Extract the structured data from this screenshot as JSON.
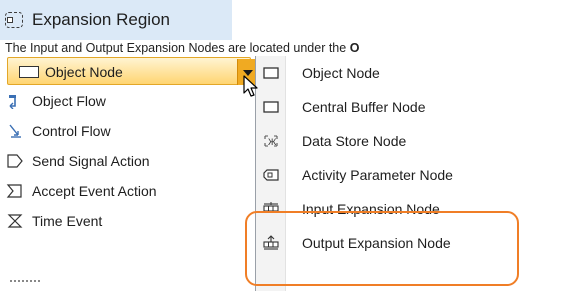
{
  "header": {
    "label": "Expansion Region",
    "icon": "expansion-region-icon"
  },
  "sentence": {
    "text": "The Input and Output Expansion Nodes are located under the ",
    "bold": "O"
  },
  "palette": {
    "selected": {
      "label": "Object Node",
      "icon": "object-node-icon"
    },
    "items": [
      {
        "label": "Object Flow",
        "icon": "object-flow-icon"
      },
      {
        "label": "Control Flow",
        "icon": "control-flow-icon"
      },
      {
        "label": "Send Signal Action",
        "icon": "send-signal-icon"
      },
      {
        "label": "Accept Event Action",
        "icon": "accept-event-icon"
      },
      {
        "label": "Time Event",
        "icon": "time-event-icon"
      }
    ]
  },
  "menu": {
    "items": [
      {
        "label": "Object Node",
        "icon": "object-node-icon"
      },
      {
        "label": "Central Buffer Node",
        "icon": "central-buffer-node-icon"
      },
      {
        "label": "Data Store Node",
        "icon": "data-store-node-icon"
      },
      {
        "label": "Activity Parameter Node",
        "icon": "activity-parameter-node-icon"
      },
      {
        "label": "Input Expansion Node",
        "icon": "input-expansion-node-icon"
      },
      {
        "label": "Output Expansion Node",
        "icon": "output-expansion-node-icon"
      }
    ]
  },
  "colors": {
    "header_bg": "#dbe9f7",
    "selection_fill": "#ffd572",
    "dropdown_button": "#f0aa22",
    "highlight_outline": "#f07e26"
  }
}
